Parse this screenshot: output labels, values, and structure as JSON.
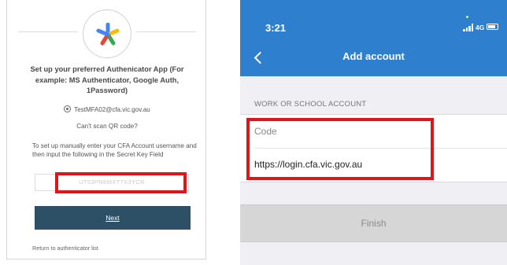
{
  "left_panel": {
    "heading": "Set up your preferred Authenicator App (For example: MS Authenticator, Google Auth, 1Password)",
    "username": "TestMFA02@cfa.vic.gov.au",
    "cant_scan": "Can't scan QR code?",
    "instructions": "To set up manually enter your CFA Account username and then input the following in the Secret Key Field",
    "secret_key": "UT53PN6MXT7X3YCR",
    "next_label": "Next",
    "return_link": "Return to authenticator list",
    "colors": {
      "button": "#2e5066"
    }
  },
  "phone": {
    "status_time": "3:21",
    "network": "4G",
    "title": "Add account",
    "section_label": "WORK OR SCHOOL ACCOUNT",
    "code_label": "Code",
    "url": "https://login.cfa.vic.gov.au",
    "finish_label": "Finish",
    "icons": [
      "chevron-left-icon",
      "signal-icon",
      "battery-icon"
    ],
    "colors": {
      "header": "#2f7fcf",
      "highlight": "#e0151b"
    }
  }
}
